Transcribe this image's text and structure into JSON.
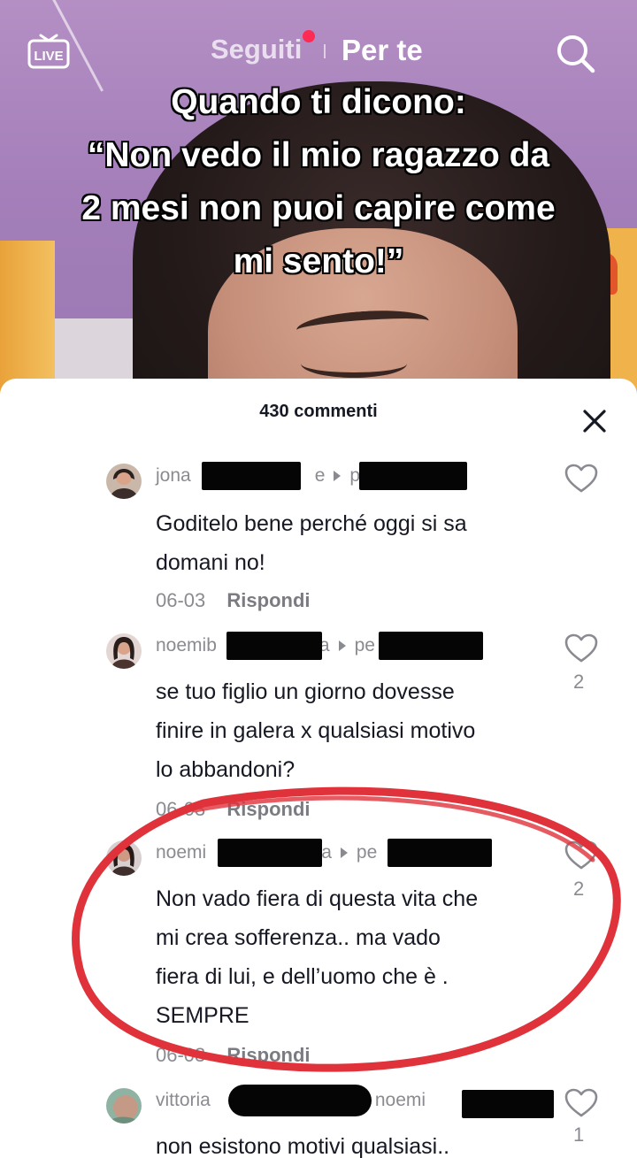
{
  "header": {
    "live_icon": "live-tv-icon",
    "live_label": "LIVE",
    "tab_following": "Seguiti",
    "tab_foryou": "Per te",
    "search_icon": "search-icon"
  },
  "video": {
    "caption_lines": [
      "Quando ti dicono:",
      "“Non vedo il mio ragazzo da",
      "2 mesi non puoi capire come",
      "mi sento!”"
    ]
  },
  "comments_panel": {
    "count_label": "430 commenti",
    "close_icon": "close-icon",
    "comments": [
      {
        "user_prefix": "jona",
        "user_suffix": "e",
        "reply_to": "pe",
        "reply_to_suffix": "",
        "text_lines": [
          "Goditelo bene perché oggi si sa",
          "domani no!"
        ],
        "date": "06-03",
        "reply_label": "Rispondi",
        "likes": ""
      },
      {
        "user_prefix": "noemib",
        "user_suffix": "a",
        "reply_to": "pe",
        "reply_to_suffix": "",
        "text_lines": [
          "se tuo figlio un giorno dovesse",
          "finire in galera x qualsiasi motivo",
          "lo abbandoni?"
        ],
        "date": "06-03",
        "reply_label": "Rispondi",
        "likes": "2"
      },
      {
        "user_prefix": "noemi",
        "user_suffix": "a",
        "reply_to": "pe",
        "reply_to_suffix": "",
        "text_lines": [
          "Non vado fiera di questa vita che",
          "mi crea sofferenza.. ma vado",
          "fiera di lui, e dell’uomo che è .",
          "SEMPRE"
        ],
        "date": "06-03",
        "reply_label": "Rispondi",
        "likes": "2"
      },
      {
        "user_prefix": "vittoria",
        "user_suffix": "",
        "reply_to": "noemi",
        "reply_to_suffix": "",
        "text_lines": [
          "non esistono motivi qualsiasi.."
        ],
        "date": "",
        "reply_label": "",
        "likes": "1"
      }
    ]
  },
  "colors": {
    "accent_red": "#fe2c55",
    "annotation_circle": "#e0323a",
    "muted_text": "#8a8b91",
    "primary_text": "#161823"
  }
}
